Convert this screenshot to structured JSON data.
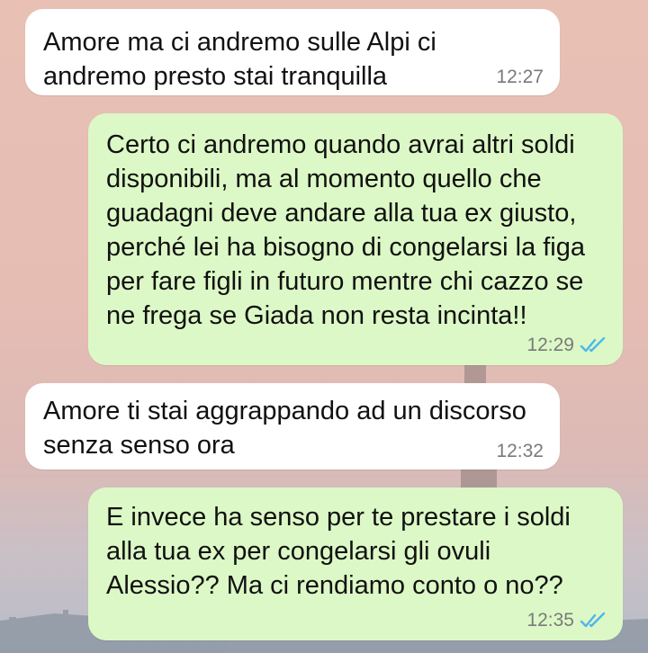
{
  "messages": [
    {
      "id": "m1",
      "direction": "incoming",
      "text": "Amore ma ci andremo sulle Alpi ci\nandremo presto stai tranquilla",
      "time": "12:27"
    },
    {
      "id": "m2",
      "direction": "outgoing",
      "text": "Certo ci andremo quando avrai altri soldi\ndisponibili, ma al momento quello che\nguadagni deve andare alla tua ex giusto,\nperché lei ha bisogno di congelarsi la figa\nper fare figli in futuro mentre chi cazzo se\nne frega se Giada non resta incinta!!",
      "time": "12:29",
      "status_icon": "double-check-read-icon",
      "status_color": "#4fb6ec"
    },
    {
      "id": "m3",
      "direction": "incoming",
      "text": "Amore ti stai aggrappando ad un discorso\nsenza senso ora",
      "time": "12:32"
    },
    {
      "id": "m4",
      "direction": "outgoing",
      "text": "E invece ha senso per te prestare i soldi\nalla tua ex per congelarsi gli ovuli\nAlessio?? Ma ci rendiamo conto o no??",
      "time": "12:35",
      "status_icon": "double-check-read-icon",
      "status_color": "#4fb6ec"
    }
  ],
  "colors": {
    "incoming_bubble": "#ffffff",
    "outgoing_bubble": "#dcf8c6",
    "timestamp": "#7a7a7a"
  }
}
